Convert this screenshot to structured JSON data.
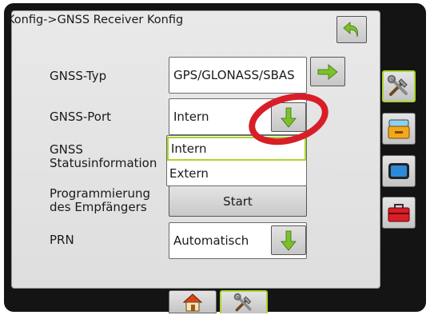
{
  "header": {
    "title": "Konfig->GNSS Receiver Konfig"
  },
  "rows": {
    "gnss_type": {
      "label": "GNSS-Typ",
      "value": "GPS/GLONASS/SBAS"
    },
    "gnss_port": {
      "label": "GNSS-Port",
      "value": "Intern"
    },
    "status_info": {
      "label_line1": "GNSS",
      "label_line2": "Statusinformation"
    },
    "programming": {
      "label_line1": "Programmierung",
      "label_line2": "des Empfängers",
      "button_label": "Start"
    },
    "prn": {
      "label": "PRN",
      "value": "Automatisch"
    }
  },
  "dropdown": {
    "options": [
      "Intern",
      "Extern"
    ],
    "selected": "Intern"
  },
  "icons": {
    "back": "undo-arrow-icon",
    "next": "arrow-right-icon",
    "down": "arrow-down-icon",
    "side": [
      "tools-icon",
      "console-icon",
      "screen-icon",
      "toolbox-icon"
    ],
    "bottom": [
      "home-icon",
      "tools-icon"
    ]
  },
  "colors": {
    "accent": "#a9d62b",
    "arrow_green": "#7cc12a",
    "highlight_ring": "#d81e28",
    "frame": "#141414"
  }
}
